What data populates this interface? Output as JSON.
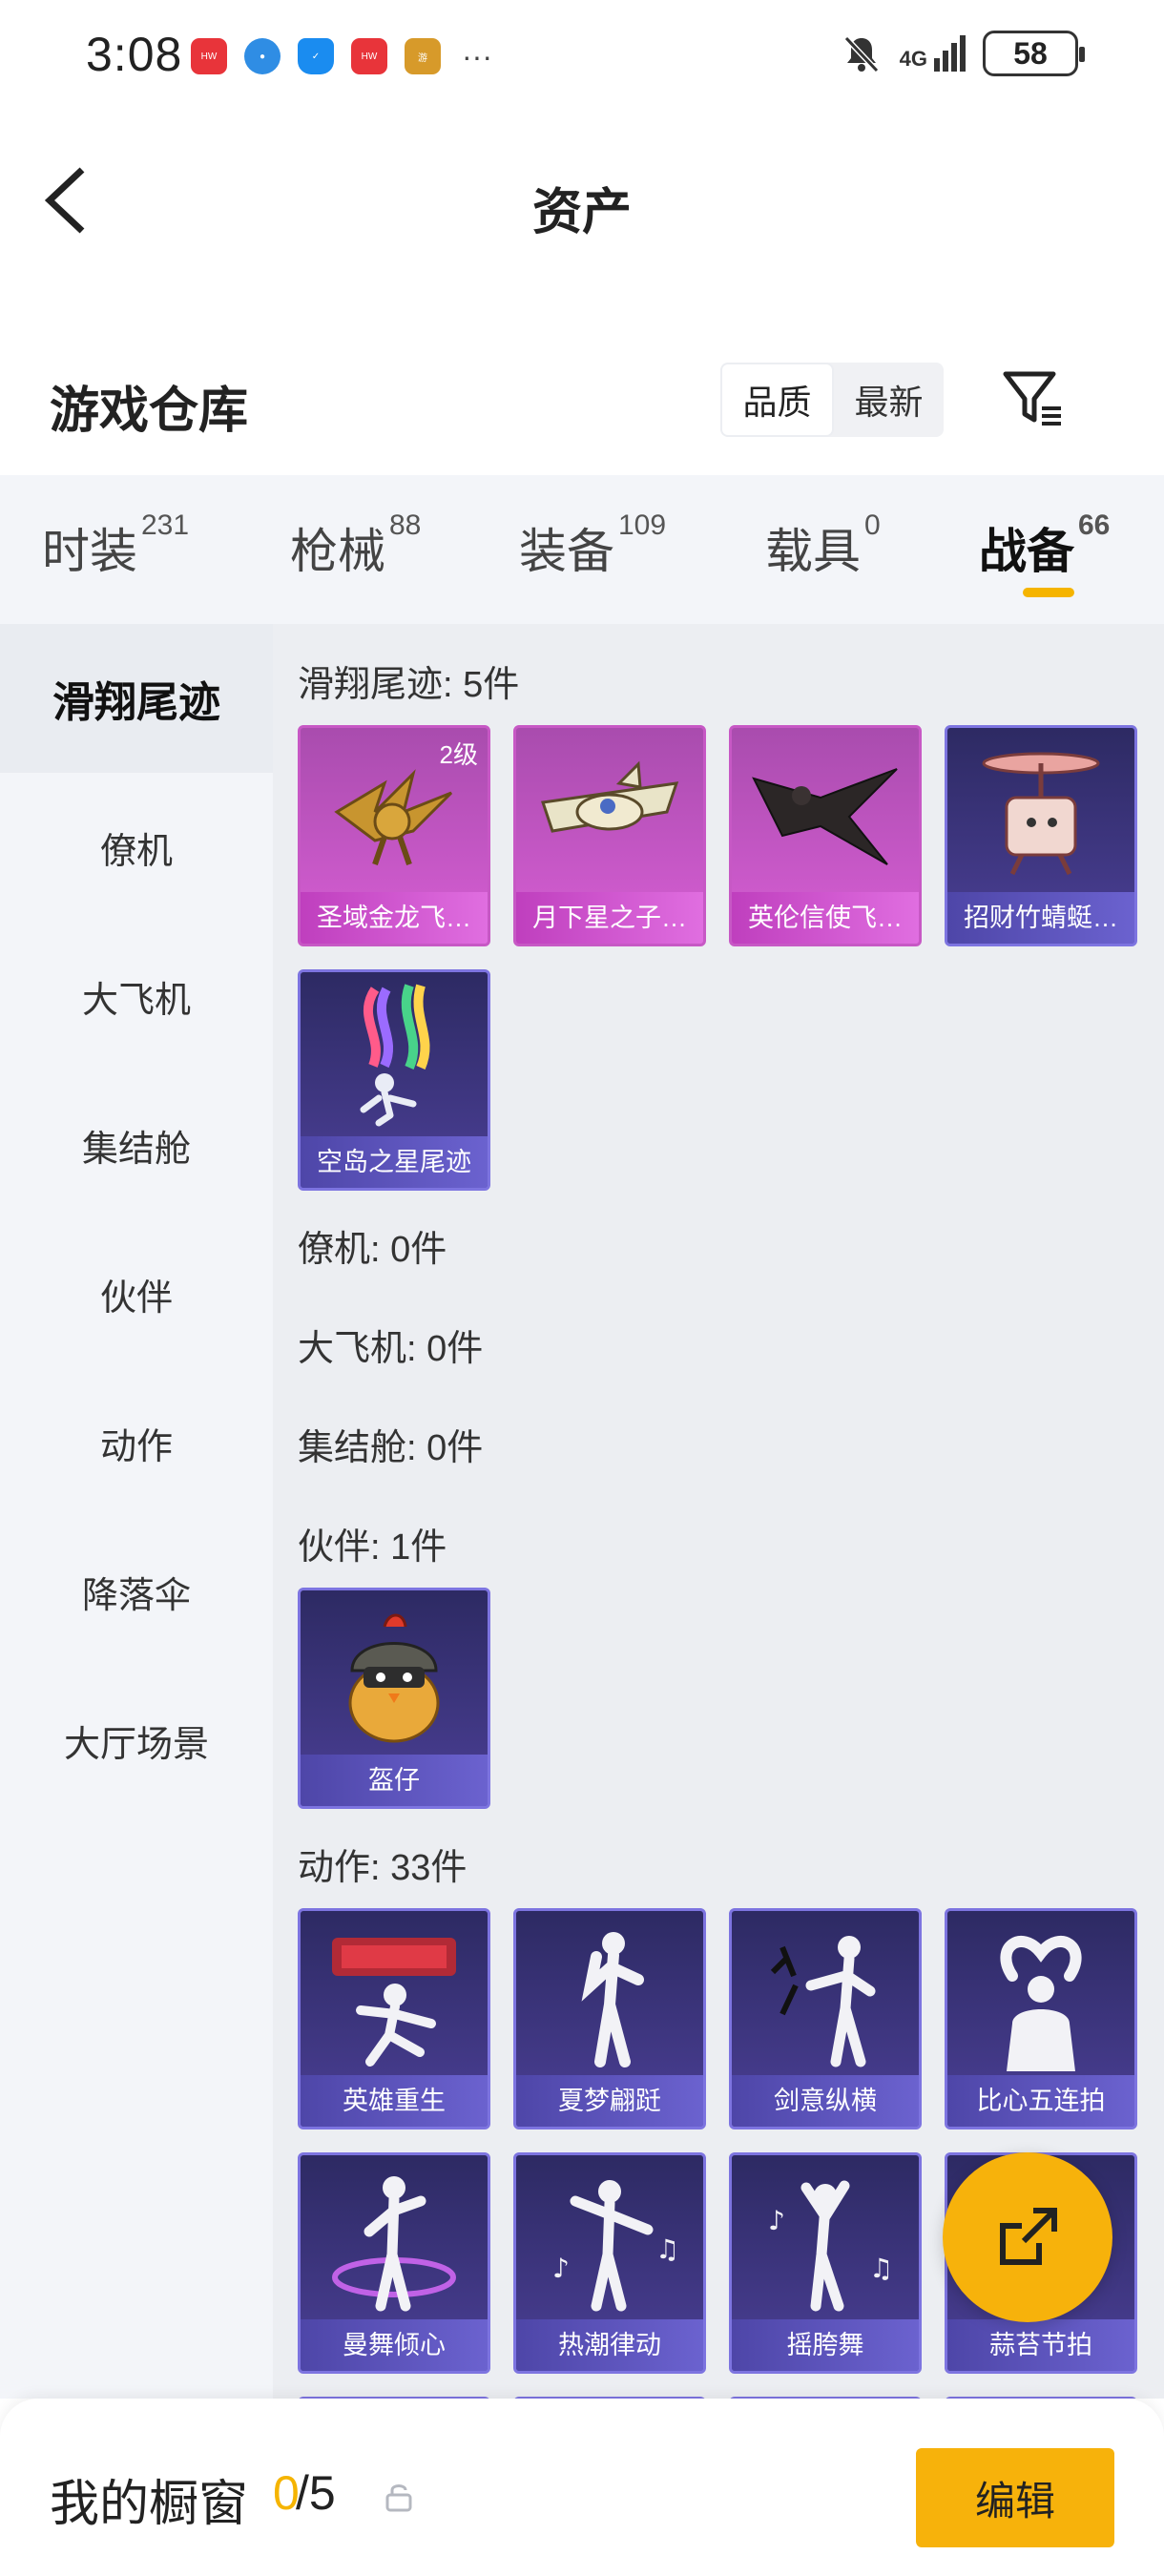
{
  "status_bar": {
    "time": "3:08",
    "network": "4G",
    "battery": "58"
  },
  "header": {
    "title": "资产"
  },
  "warehouse": {
    "title": "游戏仓库",
    "sort_quality": "品质",
    "sort_latest": "最新"
  },
  "tabs": [
    {
      "label": "时装",
      "count": "231"
    },
    {
      "label": "枪械",
      "count": "88"
    },
    {
      "label": "装备",
      "count": "109"
    },
    {
      "label": "载具",
      "count": "0"
    },
    {
      "label": "战备",
      "count": "66"
    }
  ],
  "sidebar": {
    "items": [
      "滑翔尾迹",
      "僚机",
      "大飞机",
      "集结舱",
      "伙伴",
      "动作",
      "降落伞",
      "大厅场景"
    ]
  },
  "sections": {
    "glide": {
      "title": "滑翔尾迹: 5件",
      "items": [
        {
          "label": "圣域金龙飞…",
          "level": "2级"
        },
        {
          "label": "月下星之子…"
        },
        {
          "label": "英伦信使飞…"
        },
        {
          "label": "招财竹蜻蜓…"
        },
        {
          "label": "空岛之星尾迹"
        }
      ]
    },
    "wingman": {
      "title": "僚机: 0件"
    },
    "plane": {
      "title": "大飞机: 0件"
    },
    "pod": {
      "title": "集结舱: 0件"
    },
    "partner": {
      "title": "伙伴: 1件",
      "items": [
        {
          "label": "盔仔"
        }
      ]
    },
    "action": {
      "title": "动作: 33件",
      "items": [
        {
          "label": "英雄重生"
        },
        {
          "label": "夏梦翩跹"
        },
        {
          "label": "剑意纵横"
        },
        {
          "label": "比心五连拍"
        },
        {
          "label": "曼舞倾心"
        },
        {
          "label": "热潮律动"
        },
        {
          "label": "摇胯舞"
        },
        {
          "label": "蒜苔节拍"
        }
      ]
    }
  },
  "bottom": {
    "showcase_label": "我的橱窗",
    "count_current": "0",
    "count_total": "/5",
    "edit_label": "编辑"
  }
}
